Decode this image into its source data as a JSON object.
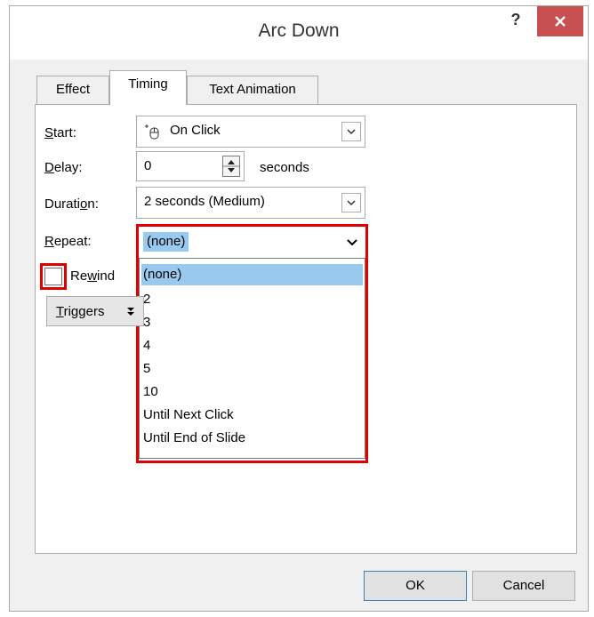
{
  "dialog": {
    "title": "Arc Down",
    "help_label": "?"
  },
  "tabs": [
    {
      "label": "Effect"
    },
    {
      "label": "Timing"
    },
    {
      "label": "Text Animation"
    }
  ],
  "timing": {
    "start": {
      "label_pre": "",
      "label_ul": "S",
      "label_post": "tart:",
      "value": "On Click"
    },
    "delay": {
      "label_pre": "",
      "label_ul": "D",
      "label_post": "elay:",
      "value": "0",
      "unit": "seconds"
    },
    "duration": {
      "label_pre": "Durati",
      "label_ul": "o",
      "label_post": "n:",
      "value": "2 seconds (Medium)"
    },
    "repeat": {
      "label_pre": "",
      "label_ul": "R",
      "label_post": "epeat:",
      "value": "(none)",
      "options": [
        "(none)",
        "2",
        "3",
        "4",
        "5",
        "10",
        "Until Next Click",
        "Until End of Slide"
      ]
    },
    "rewind": {
      "label_pre": "Re",
      "label_ul": "w",
      "label_post": "ind",
      "checked": false
    },
    "triggers": {
      "label_pre": "",
      "label_ul": "T",
      "label_post": "riggers"
    }
  },
  "buttons": {
    "ok": "OK",
    "cancel": "Cancel"
  },
  "colors": {
    "highlight": "#e00000",
    "selection": "#99c9ef",
    "close_button": "#c75050"
  }
}
